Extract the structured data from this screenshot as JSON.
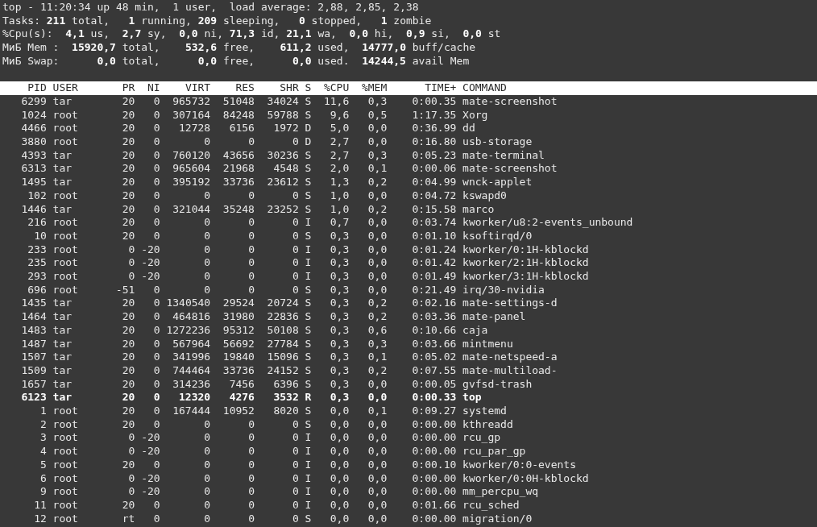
{
  "summary": [
    "top - 11:20:34 up 48 min,  1 user,  load average: 2,88, 2,85, 2,38",
    "Tasks: **211** total,   **1** running, **209** sleeping,   **0** stopped,   **1** zombie",
    "%Cpu(s):  **4,1** us,  **2,7** sy,  **0,0** ni, **71,3** id, **21,1** wa,  **0,0** hi,  **0,9** si,  **0,0** st",
    "МиБ Mem :  **15920,7** total,    **532,6** free,    **611,2** used,  **14777,0** buff/cache",
    "МиБ Swap:      **0,0** total,      **0,0** free,      **0,0** used.  **14244,5** avail Mem"
  ],
  "table": {
    "columns": [
      "PID",
      "USER",
      "PR",
      "NI",
      "VIRT",
      "RES",
      "SHR",
      "S",
      "%CPU",
      "%MEM",
      "TIME+",
      "COMMAND"
    ],
    "rows": [
      {
        "cells": [
          "6299",
          "tar",
          "20",
          "0",
          "965732",
          "51048",
          "34024",
          "S",
          "11,6",
          "0,3",
          "0:00.35",
          "mate-screenshot"
        ],
        "highlighted": false
      },
      {
        "cells": [
          "1024",
          "root",
          "20",
          "0",
          "307164",
          "84248",
          "59788",
          "S",
          "9,6",
          "0,5",
          "1:17.35",
          "Xorg"
        ],
        "highlighted": false
      },
      {
        "cells": [
          "4466",
          "root",
          "20",
          "0",
          "12728",
          "6156",
          "1972",
          "D",
          "5,0",
          "0,0",
          "0:36.99",
          "dd"
        ],
        "highlighted": false
      },
      {
        "cells": [
          "3880",
          "root",
          "20",
          "0",
          "0",
          "0",
          "0",
          "D",
          "2,7",
          "0,0",
          "0:16.80",
          "usb-storage"
        ],
        "highlighted": false
      },
      {
        "cells": [
          "4393",
          "tar",
          "20",
          "0",
          "760120",
          "43656",
          "30236",
          "S",
          "2,7",
          "0,3",
          "0:05.23",
          "mate-terminal"
        ],
        "highlighted": false
      },
      {
        "cells": [
          "6313",
          "tar",
          "20",
          "0",
          "965604",
          "21968",
          "4548",
          "S",
          "2,0",
          "0,1",
          "0:00.06",
          "mate-screenshot"
        ],
        "highlighted": false
      },
      {
        "cells": [
          "1495",
          "tar",
          "20",
          "0",
          "395192",
          "33736",
          "23612",
          "S",
          "1,3",
          "0,2",
          "0:04.99",
          "wnck-applet"
        ],
        "highlighted": false
      },
      {
        "cells": [
          "102",
          "root",
          "20",
          "0",
          "0",
          "0",
          "0",
          "S",
          "1,0",
          "0,0",
          "0:04.72",
          "kswapd0"
        ],
        "highlighted": false
      },
      {
        "cells": [
          "1446",
          "tar",
          "20",
          "0",
          "321044",
          "35248",
          "23252",
          "S",
          "1,0",
          "0,2",
          "0:15.58",
          "marco"
        ],
        "highlighted": false
      },
      {
        "cells": [
          "216",
          "root",
          "20",
          "0",
          "0",
          "0",
          "0",
          "I",
          "0,7",
          "0,0",
          "0:03.74",
          "kworker/u8:2-events_unbound"
        ],
        "highlighted": false
      },
      {
        "cells": [
          "10",
          "root",
          "20",
          "0",
          "0",
          "0",
          "0",
          "S",
          "0,3",
          "0,0",
          "0:01.10",
          "ksoftirqd/0"
        ],
        "highlighted": false
      },
      {
        "cells": [
          "233",
          "root",
          "0",
          "-20",
          "0",
          "0",
          "0",
          "I",
          "0,3",
          "0,0",
          "0:01.24",
          "kworker/0:1H-kblockd"
        ],
        "highlighted": false
      },
      {
        "cells": [
          "235",
          "root",
          "0",
          "-20",
          "0",
          "0",
          "0",
          "I",
          "0,3",
          "0,0",
          "0:01.42",
          "kworker/2:1H-kblockd"
        ],
        "highlighted": false
      },
      {
        "cells": [
          "293",
          "root",
          "0",
          "-20",
          "0",
          "0",
          "0",
          "I",
          "0,3",
          "0,0",
          "0:01.49",
          "kworker/3:1H-kblockd"
        ],
        "highlighted": false
      },
      {
        "cells": [
          "696",
          "root",
          "-51",
          "0",
          "0",
          "0",
          "0",
          "S",
          "0,3",
          "0,0",
          "0:21.49",
          "irq/30-nvidia"
        ],
        "highlighted": false
      },
      {
        "cells": [
          "1435",
          "tar",
          "20",
          "0",
          "1340540",
          "29524",
          "20724",
          "S",
          "0,3",
          "0,2",
          "0:02.16",
          "mate-settings-d"
        ],
        "highlighted": false
      },
      {
        "cells": [
          "1464",
          "tar",
          "20",
          "0",
          "464816",
          "31980",
          "22836",
          "S",
          "0,3",
          "0,2",
          "0:03.36",
          "mate-panel"
        ],
        "highlighted": false
      },
      {
        "cells": [
          "1483",
          "tar",
          "20",
          "0",
          "1272236",
          "95312",
          "50108",
          "S",
          "0,3",
          "0,6",
          "0:10.66",
          "caja"
        ],
        "highlighted": false
      },
      {
        "cells": [
          "1487",
          "tar",
          "20",
          "0",
          "567964",
          "56692",
          "27784",
          "S",
          "0,3",
          "0,3",
          "0:03.66",
          "mintmenu"
        ],
        "highlighted": false
      },
      {
        "cells": [
          "1507",
          "tar",
          "20",
          "0",
          "341996",
          "19840",
          "15096",
          "S",
          "0,3",
          "0,1",
          "0:05.02",
          "mate-netspeed-a"
        ],
        "highlighted": false
      },
      {
        "cells": [
          "1509",
          "tar",
          "20",
          "0",
          "744464",
          "33736",
          "24152",
          "S",
          "0,3",
          "0,2",
          "0:07.55",
          "mate-multiload-"
        ],
        "highlighted": false
      },
      {
        "cells": [
          "1657",
          "tar",
          "20",
          "0",
          "314236",
          "7456",
          "6396",
          "S",
          "0,3",
          "0,0",
          "0:00.05",
          "gvfsd-trash"
        ],
        "highlighted": false
      },
      {
        "cells": [
          "6123",
          "tar",
          "20",
          "0",
          "12320",
          "4276",
          "3532",
          "R",
          "0,3",
          "0,0",
          "0:00.33",
          "top"
        ],
        "highlighted": true
      },
      {
        "cells": [
          "1",
          "root",
          "20",
          "0",
          "167444",
          "10952",
          "8020",
          "S",
          "0,0",
          "0,1",
          "0:09.27",
          "systemd"
        ],
        "highlighted": false
      },
      {
        "cells": [
          "2",
          "root",
          "20",
          "0",
          "0",
          "0",
          "0",
          "S",
          "0,0",
          "0,0",
          "0:00.00",
          "kthreadd"
        ],
        "highlighted": false
      },
      {
        "cells": [
          "3",
          "root",
          "0",
          "-20",
          "0",
          "0",
          "0",
          "I",
          "0,0",
          "0,0",
          "0:00.00",
          "rcu_gp"
        ],
        "highlighted": false
      },
      {
        "cells": [
          "4",
          "root",
          "0",
          "-20",
          "0",
          "0",
          "0",
          "I",
          "0,0",
          "0,0",
          "0:00.00",
          "rcu_par_gp"
        ],
        "highlighted": false
      },
      {
        "cells": [
          "5",
          "root",
          "20",
          "0",
          "0",
          "0",
          "0",
          "I",
          "0,0",
          "0,0",
          "0:00.10",
          "kworker/0:0-events"
        ],
        "highlighted": false
      },
      {
        "cells": [
          "6",
          "root",
          "0",
          "-20",
          "0",
          "0",
          "0",
          "I",
          "0,0",
          "0,0",
          "0:00.00",
          "kworker/0:0H-kblockd"
        ],
        "highlighted": false
      },
      {
        "cells": [
          "9",
          "root",
          "0",
          "-20",
          "0",
          "0",
          "0",
          "I",
          "0,0",
          "0,0",
          "0:00.00",
          "mm_percpu_wq"
        ],
        "highlighted": false
      },
      {
        "cells": [
          "11",
          "root",
          "20",
          "0",
          "0",
          "0",
          "0",
          "I",
          "0,0",
          "0,0",
          "0:01.66",
          "rcu_sched"
        ],
        "highlighted": false
      },
      {
        "cells": [
          "12",
          "root",
          "rt",
          "0",
          "0",
          "0",
          "0",
          "S",
          "0,0",
          "0,0",
          "0:00.00",
          "migration/0"
        ],
        "highlighted": false
      }
    ]
  }
}
